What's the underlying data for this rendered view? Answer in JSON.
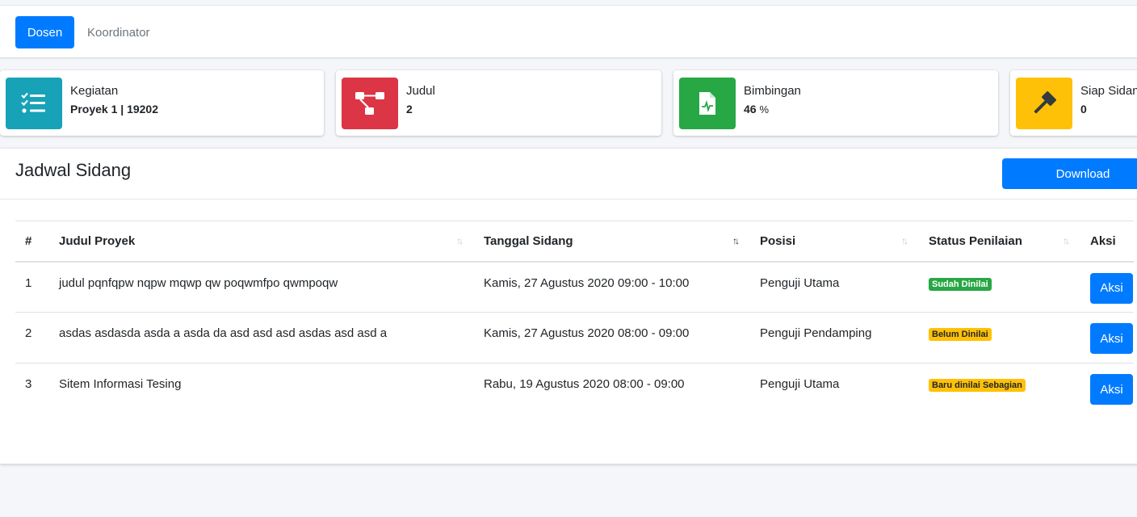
{
  "tabs": {
    "active": "Dosen",
    "other": "Koordinator"
  },
  "info_boxes": [
    {
      "label": "Kegiatan",
      "value": "Proyek 1 | 19202",
      "unit": "",
      "color": "#17a2b8",
      "icon": "checklist-icon"
    },
    {
      "label": "Judul",
      "value": "2",
      "unit": "",
      "color": "#dc3545",
      "icon": "project-diagram-icon"
    },
    {
      "label": "Bimbingan",
      "value": "46",
      "unit": "%",
      "color": "#28a745",
      "icon": "file-medical-icon"
    },
    {
      "label": "Siap Sidang",
      "value": "0",
      "unit": "",
      "color": "#ffc107",
      "icon": "gavel-icon"
    }
  ],
  "card": {
    "title": "Jadwal Sidang",
    "download_label": "Download"
  },
  "table": {
    "headers": [
      "#",
      "Judul Proyek",
      "Tanggal Sidang",
      "Posisi",
      "Status Penilaian",
      "Aksi"
    ],
    "rows": [
      {
        "no": "1",
        "judul": "judul pqnfqpw nqpw mqwp qw poqwmfpo qwmpoqw",
        "tanggal": "Kamis, 27 Agustus 2020 09:00 - 10:00",
        "posisi": "Penguji Utama",
        "status": "Sudah Dinilai",
        "status_type": "success",
        "aksi": "Aksi"
      },
      {
        "no": "2",
        "judul": "asdas asdasda asda a asda da asd asd asd asdas asd asd a",
        "tanggal": "Kamis, 27 Agustus 2020 08:00 - 09:00",
        "posisi": "Penguji Pendamping",
        "status": "Belum Dinilai",
        "status_type": "warning",
        "aksi": "Aksi"
      },
      {
        "no": "3",
        "judul": "Sitem Informasi Tesing",
        "tanggal": "Rabu, 19 Agustus 2020 08:00 - 09:00",
        "posisi": "Penguji Utama",
        "status": "Baru dinilai Sebagian",
        "status_type": "warning",
        "aksi": "Aksi"
      }
    ]
  },
  "colors": {
    "primary": "#007bff",
    "success": "#28a745",
    "warning": "#ffc107",
    "danger": "#dc3545",
    "info": "#17a2b8"
  }
}
